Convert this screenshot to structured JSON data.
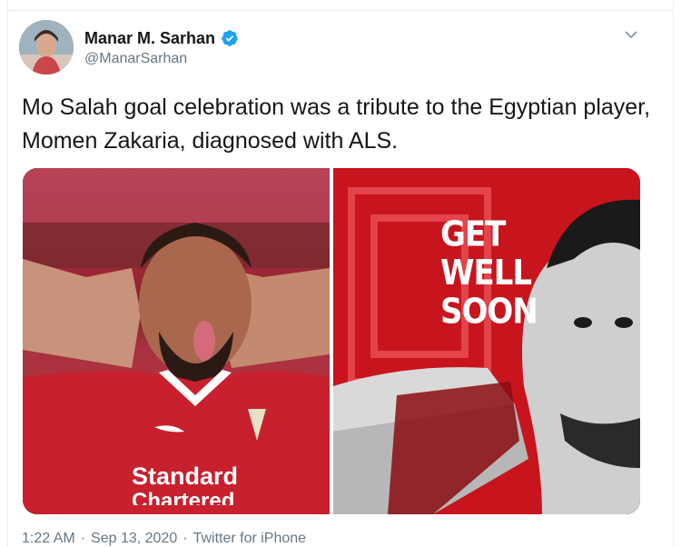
{
  "author": {
    "name": "Manar M. Sarhan",
    "handle": "@ManarSarhan",
    "verified": true
  },
  "tweet": {
    "text": "Mo Salah goal celebration was a tribute to the Egyptian player, Momen Zakaria, diagnosed with ALS."
  },
  "media": {
    "right_overlay": [
      "GET",
      "WELL",
      "SOON"
    ],
    "left_sponsor": [
      "Standard",
      "Chartered"
    ]
  },
  "footer": {
    "time": "1:22 AM",
    "sep1": "·",
    "date": "Sep 13, 2020",
    "sep2": "·",
    "source": "Twitter for iPhone"
  },
  "colors": {
    "verified": "#1da1f2",
    "secondary_text": "#657786",
    "liverpool_red": "#c8141d"
  },
  "icons": {
    "verified": "verified-badge-icon",
    "caret": "chevron-down-icon"
  }
}
